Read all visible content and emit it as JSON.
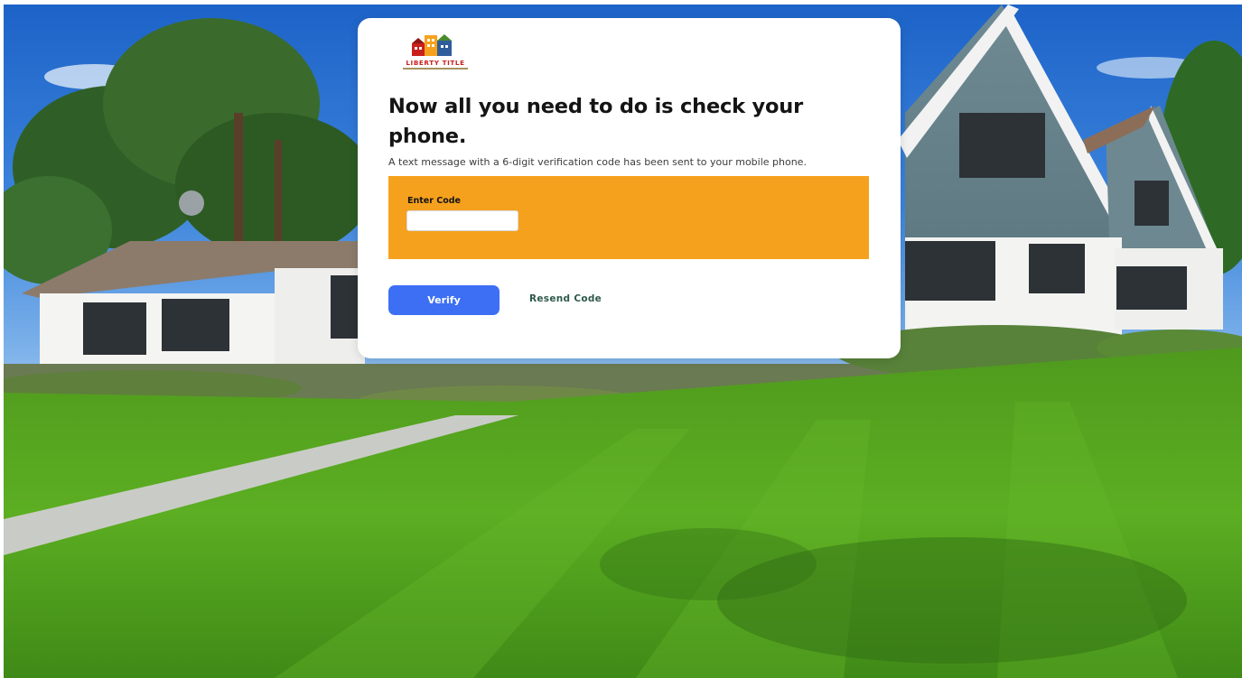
{
  "brand": {
    "logo_text": "LIBERTY TITLE",
    "colors": {
      "red": "#c9201e",
      "orange": "#f6a11d",
      "blue": "#2f5d9c",
      "green": "#4a8a2c"
    }
  },
  "card": {
    "heading": "Now all you need to do is check your phone.",
    "subtext": "A text message with a 6-digit verification code has been sent to your mobile phone."
  },
  "code_form": {
    "label": "Enter Code",
    "value": "",
    "panel_color": "#f6a11d"
  },
  "actions": {
    "verify_label": "Verify",
    "verify_color": "#3d6ff5",
    "resend_label": "Resend Code"
  },
  "background": {
    "icon": "house-photo"
  }
}
